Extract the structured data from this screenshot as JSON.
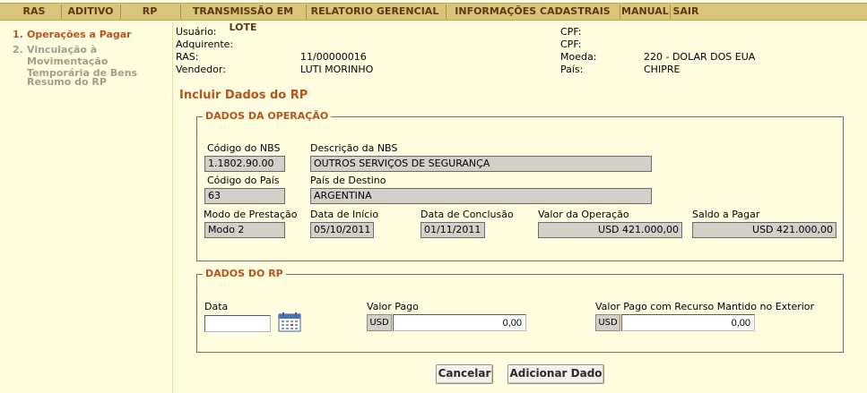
{
  "menu": {
    "items": [
      "RAS",
      "ADITIVO",
      "RP",
      "TRANSMISSÃO EM LOTE",
      "RELATORIO GERENCIAL",
      "INFORMAÇÕES CADASTRAIS",
      "MANUAL",
      "SAIR"
    ]
  },
  "sidebar": {
    "steps": [
      {
        "num": "1.",
        "label": "Operações a Pagar",
        "state": "active"
      },
      {
        "num": "2.",
        "label": "Vinculação à Movimentação Temporária de Bens",
        "state": "inactive"
      },
      {
        "num": "",
        "label": "Resumo do RP",
        "state": "inactive"
      }
    ]
  },
  "header_info": {
    "usuario_label": "Usuário:",
    "usuario_value": "",
    "adquirente_label": "Adquirente:",
    "adquirente_value": "",
    "ras_label": "RAS:",
    "ras_value": "11/00000016",
    "vendedor_label": "Vendedor:",
    "vendedor_value": "LUTI MORINHO",
    "cpf1_label": "CPF:",
    "cpf1_value": "",
    "cpf2_label": "CPF:",
    "cpf2_value": "",
    "moeda_label": "Moeda:",
    "moeda_value": "220 - DOLAR DOS EUA",
    "pais_label": "País:",
    "pais_value": "CHIPRE"
  },
  "page_title": "Incluir Dados do RP",
  "operacao": {
    "legend": "DADOS DA OPERAÇÃO",
    "codigo_nbs_label": "Código do NBS",
    "codigo_nbs_value": "1.1802.90.00",
    "descricao_nbs_label": "Descrição da NBS",
    "descricao_nbs_value": "OUTROS SERVIÇOS DE SEGURANÇA",
    "codigo_pais_label": "Código do País",
    "codigo_pais_value": "63",
    "pais_destino_label": "País de Destino",
    "pais_destino_value": "ARGENTINA",
    "modo_label": "Modo de Prestação",
    "modo_value": "Modo 2",
    "data_inicio_label": "Data de Início",
    "data_inicio_value": "05/10/2011",
    "data_conclusao_label": "Data de Conclusão",
    "data_conclusao_value": "01/11/2011",
    "valor_operacao_label": "Valor da Operação",
    "valor_operacao_value": "USD 421.000,00",
    "saldo_label": "Saldo a Pagar",
    "saldo_value": "USD 421.000,00"
  },
  "rp": {
    "legend": "DADOS DO RP",
    "data_label": "Data",
    "data_value": "",
    "valor_pago_label": "Valor Pago",
    "valor_pago_currency": "USD",
    "valor_pago_value": "0,00",
    "valor_exterior_label": "Valor Pago com Recurso Mantido no Exterior",
    "valor_exterior_currency": "USD",
    "valor_exterior_value": "0,00",
    "calendar_icon": "calendar-icon"
  },
  "buttons": {
    "cancel": "Cancelar",
    "add": "Adicionar Dado"
  },
  "colors": {
    "menu_bg": "#d9c57a",
    "menu_text": "#5a3a12",
    "accent": "#b5541f",
    "page_bg": "#fffde0",
    "readonly_bg": "#d3d0c8"
  }
}
